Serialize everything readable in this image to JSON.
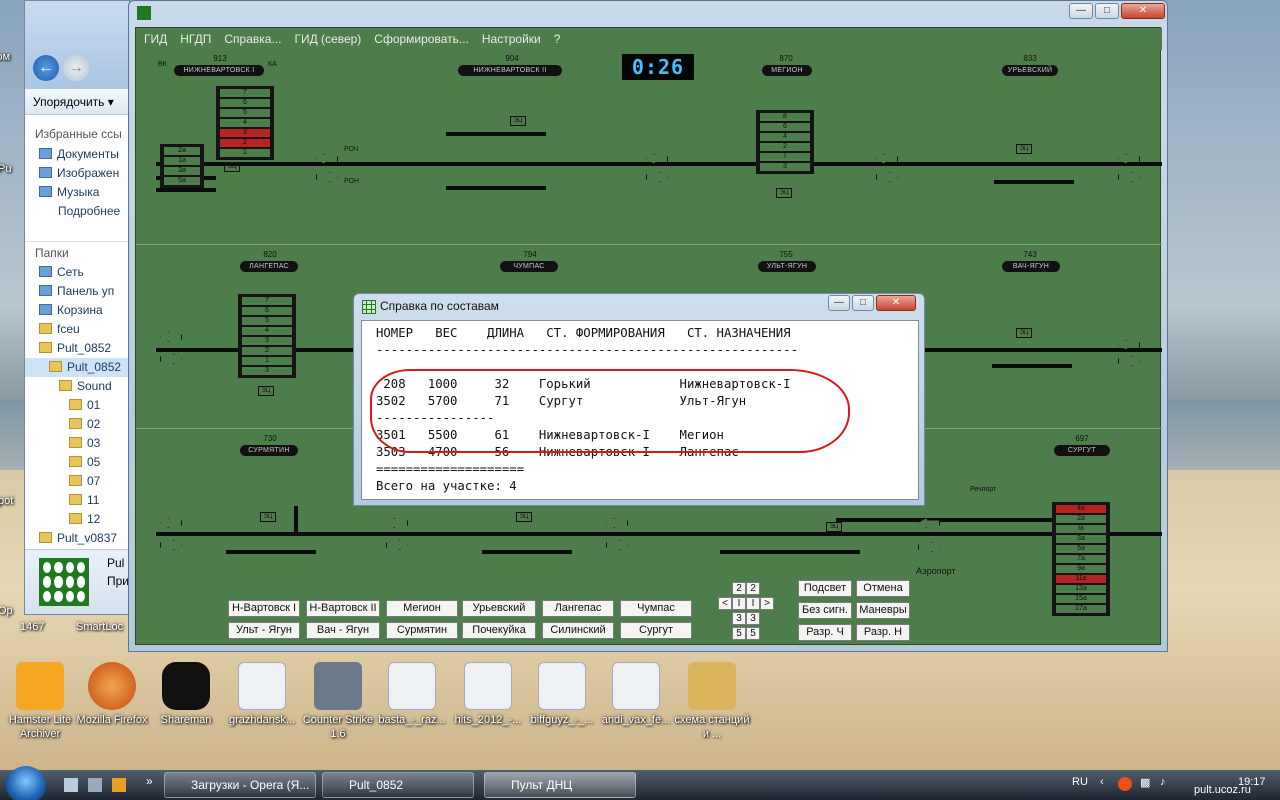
{
  "desktop": {
    "icons": [
      {
        "label": "Hamster Lite Archiver",
        "color": "#f5a623"
      },
      {
        "label": "Mozilla Firefox",
        "color": "#e2661a"
      },
      {
        "label": "Shareman",
        "color": "#111111"
      },
      {
        "label": "grazhdansk...",
        "color": "#e8e8e8"
      },
      {
        "label": "Counter Strike 1.6",
        "color": "#6a7a8a"
      },
      {
        "label": "basta_-_raz...",
        "color": "#e8e8e8"
      },
      {
        "label": "hits_2012_-...",
        "color": "#e8e8e8"
      },
      {
        "label": "biffguyz_-_...",
        "color": "#e8e8e8"
      },
      {
        "label": "andi_vax_fe...",
        "color": "#e8e8e8"
      },
      {
        "label": "схема станций и ...",
        "color": "#d9b45a"
      }
    ],
    "left_labels": [
      "Ком",
      "Pu",
      "pot",
      "Op",
      "1467"
    ],
    "smartloc": "SmartLoc"
  },
  "explorer": {
    "organize": "Упорядочить",
    "favorites_header": "Избранные ссы",
    "favorites": [
      "Документы",
      "Изображен",
      "Музыка",
      "Подробнее"
    ],
    "folders_header": "Папки",
    "folders": [
      "Сеть",
      "Панель уп",
      "Корзина",
      "fceu",
      "Pult_0852",
      "Pult_0852",
      "Sound",
      "01",
      "02",
      "03",
      "05",
      "07",
      "11",
      "12",
      "Pult_v0837"
    ],
    "preview_name": "Pul",
    "preview_type": "При"
  },
  "window": {
    "menu": [
      "ГИД",
      "НГДП",
      "Справка...",
      "ГИД (север)",
      "Сформировать...",
      "Настройки",
      "?"
    ],
    "clock": "0:26"
  },
  "stations": [
    {
      "name": "НИЖНЕВАРТОВСК I",
      "num": "913"
    },
    {
      "name": "НИЖНЕВАРТОВСК II",
      "num": "904"
    },
    {
      "name": "МЕГИОН",
      "num": "870"
    },
    {
      "name": "УРЬЕВСКИЙ",
      "num": "833"
    },
    {
      "name": "ЛАНГЕПАС",
      "num": "820"
    },
    {
      "name": "ЧУМПАС",
      "num": "794"
    },
    {
      "name": "УЛЬТ-ЯГУН",
      "num": "755"
    },
    {
      "name": "ВАЧ-ЯГУН",
      "num": "743"
    },
    {
      "name": "СУРМЯТИН",
      "num": "730"
    },
    {
      "name": "СУРГУТ",
      "num": "697"
    }
  ],
  "tower_tracks": {
    "nv1": [
      "7",
      "6",
      "5",
      "4",
      "3",
      "2",
      "1"
    ],
    "nv1_left": [
      "2а",
      "1а",
      "3а",
      "5а"
    ],
    "megion": [
      "8",
      "6",
      "4",
      "2",
      "I",
      "3"
    ],
    "langepas": [
      "7",
      "6",
      "5",
      "4",
      "3",
      "2",
      "1",
      "3"
    ],
    "surgut": [
      "4а",
      "2а",
      "Iа",
      "3а",
      "5а",
      "7а",
      "9а",
      "11а",
      "13а",
      "15а",
      "17а"
    ]
  },
  "labels": {
    "ec": "ЭЦ",
    "rechport": "Речпорт",
    "airport": "Аэропорт",
    "bk": "ВК",
    "ka": "КА",
    "ch": "Ч",
    "n": "Н",
    "roch": "РОЧ",
    "ron": "РОН"
  },
  "station_buttons": [
    "Н-Вартовск I",
    "Н-Вартовск II",
    "Мегион",
    "Урьевский",
    "Лангепас",
    "Чумпас",
    "Ульт - Ягун",
    "Вач - Ягун",
    "Сурмятин",
    "Почекуйка",
    "Силинский",
    "Сургут"
  ],
  "numpad": [
    "2",
    "2",
    "<",
    "I",
    "I",
    ">",
    "3",
    "3",
    "5",
    "5"
  ],
  "control_buttons": [
    "Подсвет",
    "Отмена",
    "Без сигн.",
    "Маневры",
    "Разр. Ч",
    "Разр. Н"
  ],
  "dialog": {
    "title": "Справка по составам",
    "header": "НОМЕР   ВЕС    ДЛИНА   СТ. ФОРМИРОВАНИЯ   СТ. НАЗНАЧЕНИЯ",
    "separator": "---------------------------------------------------------",
    "rows": [
      " 208   1000     32    Горький            Нижневартовск-I",
      "3502   5700     71    Сургут             Ульт-Ягун",
      "----------------",
      "3501   5500     61    Нижневартовск-I    Мегион",
      "3503   4700     56    Нижневартовск-I    Лангепас",
      "===================="
    ],
    "total": "Всего на участке: 4"
  },
  "taskbar": {
    "items": [
      "Загрузки - Opera (Я...",
      "Pult_0852",
      "Пульт ДНЦ"
    ],
    "lang": "RU",
    "time": "19:17",
    "watermark": "pult.ucoz.ru"
  }
}
